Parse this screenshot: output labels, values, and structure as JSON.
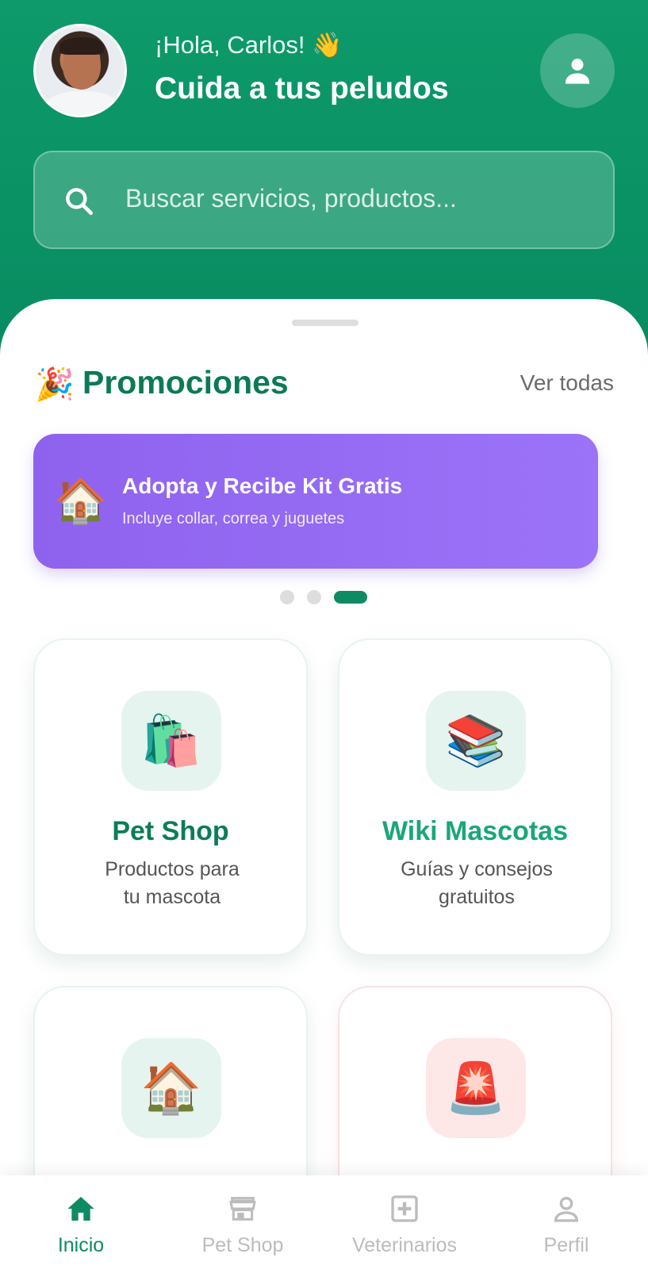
{
  "colors": {
    "brand_green": "#0e8b62",
    "header_green": "#0e9a6a",
    "banner_purple": "#9b73f8",
    "muted_gray": "#6b6b6b"
  },
  "header": {
    "greeting": "¡Hola, Carlos!",
    "greeting_emoji": "👋",
    "title": "Cuida a tus peludos",
    "avatar": "user-avatar-photo",
    "profile_icon": "person-icon"
  },
  "search": {
    "icon": "search-icon",
    "placeholder": "Buscar servicios, productos..."
  },
  "promotions": {
    "emoji": "🎉",
    "title": "Promociones",
    "see_all": "Ver todas",
    "banner": {
      "emoji": "🏠",
      "title": "Adopta y Recibe Kit Gratis",
      "subtitle": "Incluye collar, correa y juguetes"
    },
    "carousel": {
      "total": 3,
      "active_index": 2
    }
  },
  "cards": [
    {
      "emoji": "🛍️",
      "title": "Pet Shop",
      "desc1": "Productos para",
      "desc2": "tu mascota"
    },
    {
      "emoji": "📚",
      "title": "Wiki Mascotas",
      "desc1": "Guías y consejos",
      "desc2": "gratuitos"
    },
    {
      "emoji": "🏠",
      "title": "",
      "desc1": "",
      "desc2": ""
    },
    {
      "emoji": "🚨",
      "title": "",
      "desc1": "",
      "desc2": ""
    }
  ],
  "nav": {
    "items": [
      {
        "label": "Inicio",
        "icon": "home-icon",
        "active": true
      },
      {
        "label": "Pet Shop",
        "icon": "store-icon",
        "active": false
      },
      {
        "label": "Veterinarios",
        "icon": "medical-plus-icon",
        "active": false
      },
      {
        "label": "Perfil",
        "icon": "person-outline-icon",
        "active": false
      }
    ]
  }
}
